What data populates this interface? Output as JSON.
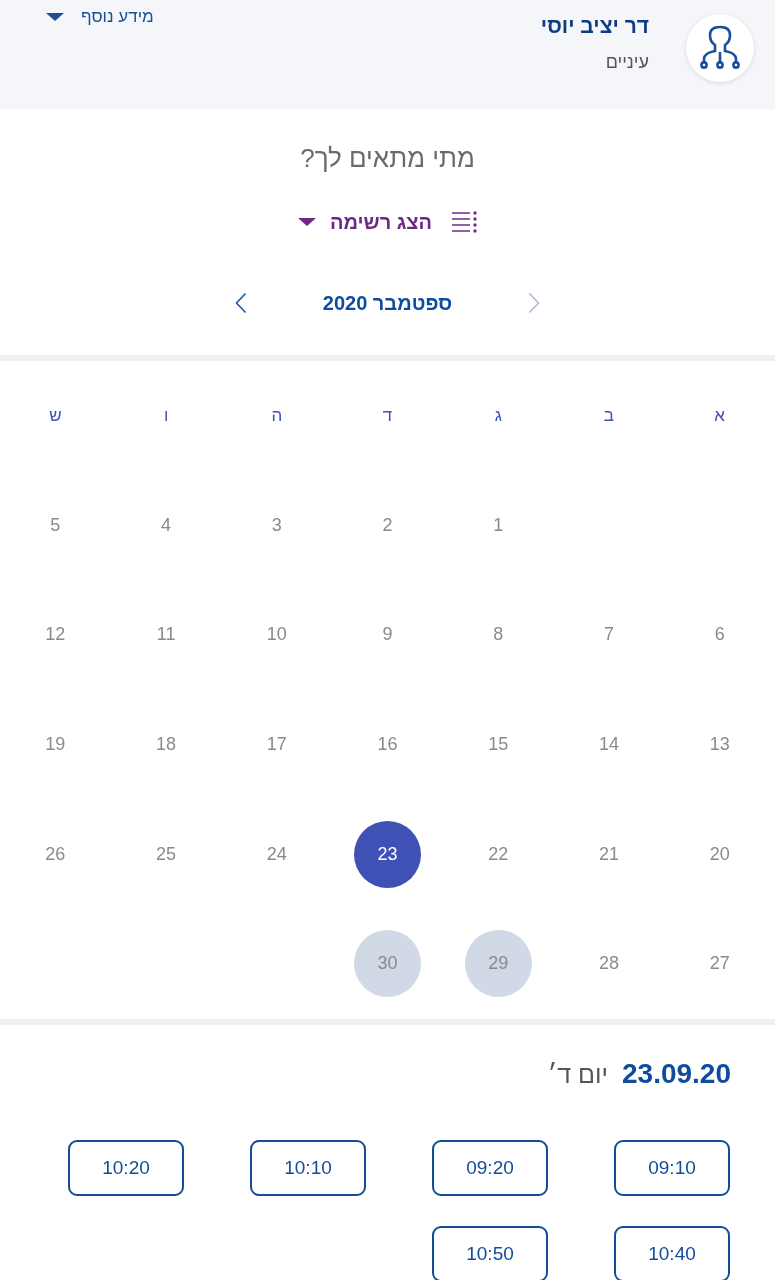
{
  "header": {
    "doctor_name": "דר יציב יוסי",
    "specialty": "עיניים",
    "more_info": "מידע נוסף"
  },
  "prompt": "מתי מתאים לך?",
  "view_toggle": {
    "label": "הצג רשימה"
  },
  "month_nav": {
    "title": "ספטמבר 2020",
    "prev": {
      "disabled": true
    },
    "next": {
      "disabled": false
    }
  },
  "calendar": {
    "weekdays": [
      "א",
      "ב",
      "ג",
      "ד",
      "ה",
      "ו",
      "ש"
    ],
    "weeks": [
      [
        {
          "label": "1",
          "selected": false,
          "highlighted": false
        },
        {
          "label": "2",
          "selected": false,
          "highlighted": false
        },
        {
          "label": "3",
          "selected": false,
          "highlighted": false
        },
        {
          "label": "4",
          "selected": false,
          "highlighted": false
        },
        {
          "label": "5",
          "selected": false,
          "highlighted": false
        }
      ],
      [
        {
          "label": "6",
          "selected": false,
          "highlighted": false
        },
        {
          "label": "7",
          "selected": false,
          "highlighted": false
        },
        {
          "label": "8",
          "selected": false,
          "highlighted": false
        },
        {
          "label": "9",
          "selected": false,
          "highlighted": false
        },
        {
          "label": "10",
          "selected": false,
          "highlighted": false
        },
        {
          "label": "11",
          "selected": false,
          "highlighted": false
        },
        {
          "label": "12",
          "selected": false,
          "highlighted": false
        }
      ],
      [
        {
          "label": "13",
          "selected": false,
          "highlighted": false
        },
        {
          "label": "14",
          "selected": false,
          "highlighted": false
        },
        {
          "label": "15",
          "selected": false,
          "highlighted": false
        },
        {
          "label": "16",
          "selected": false,
          "highlighted": false
        },
        {
          "label": "17",
          "selected": false,
          "highlighted": false
        },
        {
          "label": "18",
          "selected": false,
          "highlighted": false
        },
        {
          "label": "19",
          "selected": false,
          "highlighted": false
        }
      ],
      [
        {
          "label": "20",
          "selected": false,
          "highlighted": false
        },
        {
          "label": "21",
          "selected": false,
          "highlighted": false
        },
        {
          "label": "22",
          "selected": false,
          "highlighted": false
        },
        {
          "label": "23",
          "selected": true,
          "highlighted": false
        },
        {
          "label": "24",
          "selected": false,
          "highlighted": false
        },
        {
          "label": "25",
          "selected": false,
          "highlighted": false
        },
        {
          "label": "26",
          "selected": false,
          "highlighted": false
        }
      ],
      [
        {
          "label": "27",
          "selected": false,
          "highlighted": false
        },
        {
          "label": "28",
          "selected": false,
          "highlighted": false
        },
        {
          "label": "29",
          "selected": false,
          "highlighted": true
        },
        {
          "label": "30",
          "selected": false,
          "highlighted": true
        }
      ]
    ]
  },
  "selected_day": {
    "date": "23.09.20",
    "weekday": "יום ד׳"
  },
  "time_slots": [
    "09:10",
    "09:20",
    "10:10",
    "10:20",
    "10:40",
    "10:50"
  ]
}
